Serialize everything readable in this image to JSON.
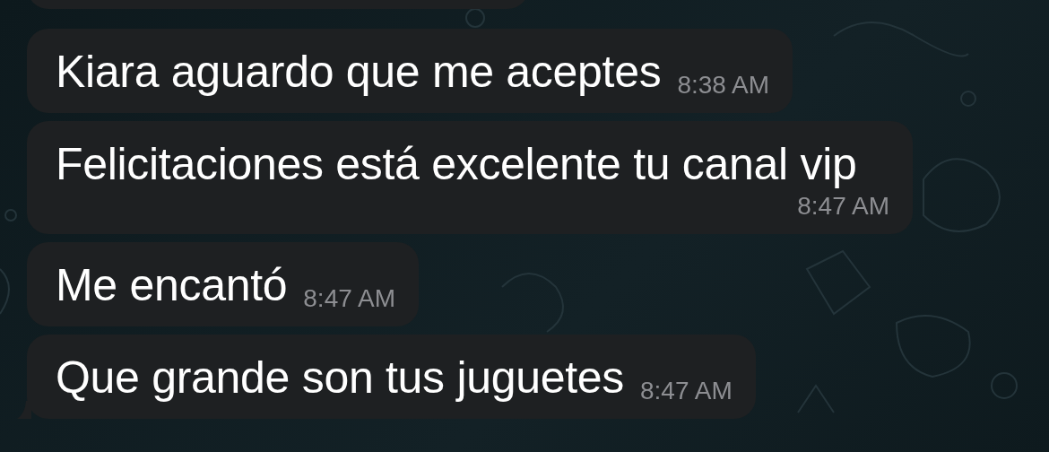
{
  "messages": [
    {
      "kind": "cut"
    },
    {
      "kind": "text",
      "text": "Kiara aguardo que me aceptes",
      "time": "8:38 AM",
      "tail": false
    },
    {
      "kind": "text",
      "text": "Felicitaciones está excelente tu canal vip",
      "time": "8:47 AM",
      "tail": false
    },
    {
      "kind": "text",
      "text": "Me encantó",
      "time": "8:47 AM",
      "tail": false
    },
    {
      "kind": "text",
      "text": "Que grande son tus juguetes",
      "time": "8:47 AM",
      "tail": true
    }
  ]
}
